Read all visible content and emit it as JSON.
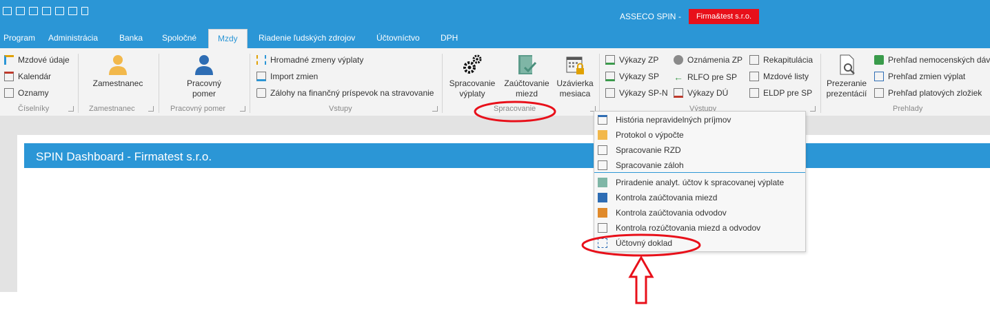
{
  "titlebar": {
    "app_name": "ASSECO SPIN",
    "separator": "-",
    "company": "Firma&test s.r.o.",
    "qat_icons": [
      "restore-icon",
      "excel-icon",
      "image-export-icon",
      "email-icon",
      "print-icon",
      "print-preview-icon",
      "pdf-export-icon"
    ]
  },
  "menu": {
    "items": [
      "Program",
      "Administrácia",
      "Banka",
      "Spoločné",
      "Mzdy",
      "Riadenie ľudských zdrojov",
      "Účtovníctvo",
      "DPH"
    ],
    "active": "Mzdy"
  },
  "ribbon": {
    "ciselniky": {
      "items": [
        "Mzdové údaje",
        "Kalendár",
        "Oznamy"
      ],
      "label": "Číselníky"
    },
    "zamestnanec": {
      "button": "Zamestnanec",
      "label": "Zamestnanec"
    },
    "pracovny_pomer": {
      "button_line1": "Pracovný",
      "button_line2": "pomer",
      "label": "Pracovný pomer"
    },
    "vstupy": {
      "items": [
        "Hromadné zmeny výplaty",
        "Import zmien",
        "Zálohy na finančný príspevok na stravovanie"
      ],
      "label": "Vstupy"
    },
    "spracovanie": {
      "buttons": [
        {
          "line1": "Spracovanie",
          "line2": "výplaty"
        },
        {
          "line1": "Zaúčtovanie",
          "line2": "miezd"
        },
        {
          "line1": "Uzávierka",
          "line2": "mesiaca"
        }
      ],
      "label": "Spracovanie"
    },
    "vystupy": {
      "col1": [
        "Výkazy ZP",
        "Výkazy SP",
        "Výkazy SP-N"
      ],
      "col2": [
        "Oznámenia ZP",
        "RLFO pre SP",
        "Výkazy DÚ"
      ],
      "col3": [
        "Rekapitulácia",
        "Mzdové listy",
        "ELDP pre SP"
      ],
      "label": "Výstupy"
    },
    "prehlady": {
      "big_line1": "Prezeranie",
      "big_line2": "prezentácií",
      "items": [
        "Prehľad nemocenských dáv",
        "Prehľad zmien výplat",
        "Prehľad platových zložiek"
      ],
      "label": "Prehlady"
    }
  },
  "dashboard": {
    "title": "SPIN Dashboard - Firmatest s.r.o."
  },
  "dropdown": {
    "group1": [
      "História nepravidelných príjmov",
      "Protokol o výpočte",
      "Spracovanie RZD",
      "Spracovanie záloh"
    ],
    "group2": [
      "Priradenie analyt. účtov k spracovanej výplate",
      "Kontrola zaúčtovania miezd",
      "Kontrola zaúčtovania odvodov",
      "Kontrola rozúčtovania miezd a odvodov",
      "Účtovný doklad"
    ]
  },
  "colors": {
    "accent": "#2b96d6",
    "badge": "#e8101a",
    "annotation": "#e8101a"
  }
}
